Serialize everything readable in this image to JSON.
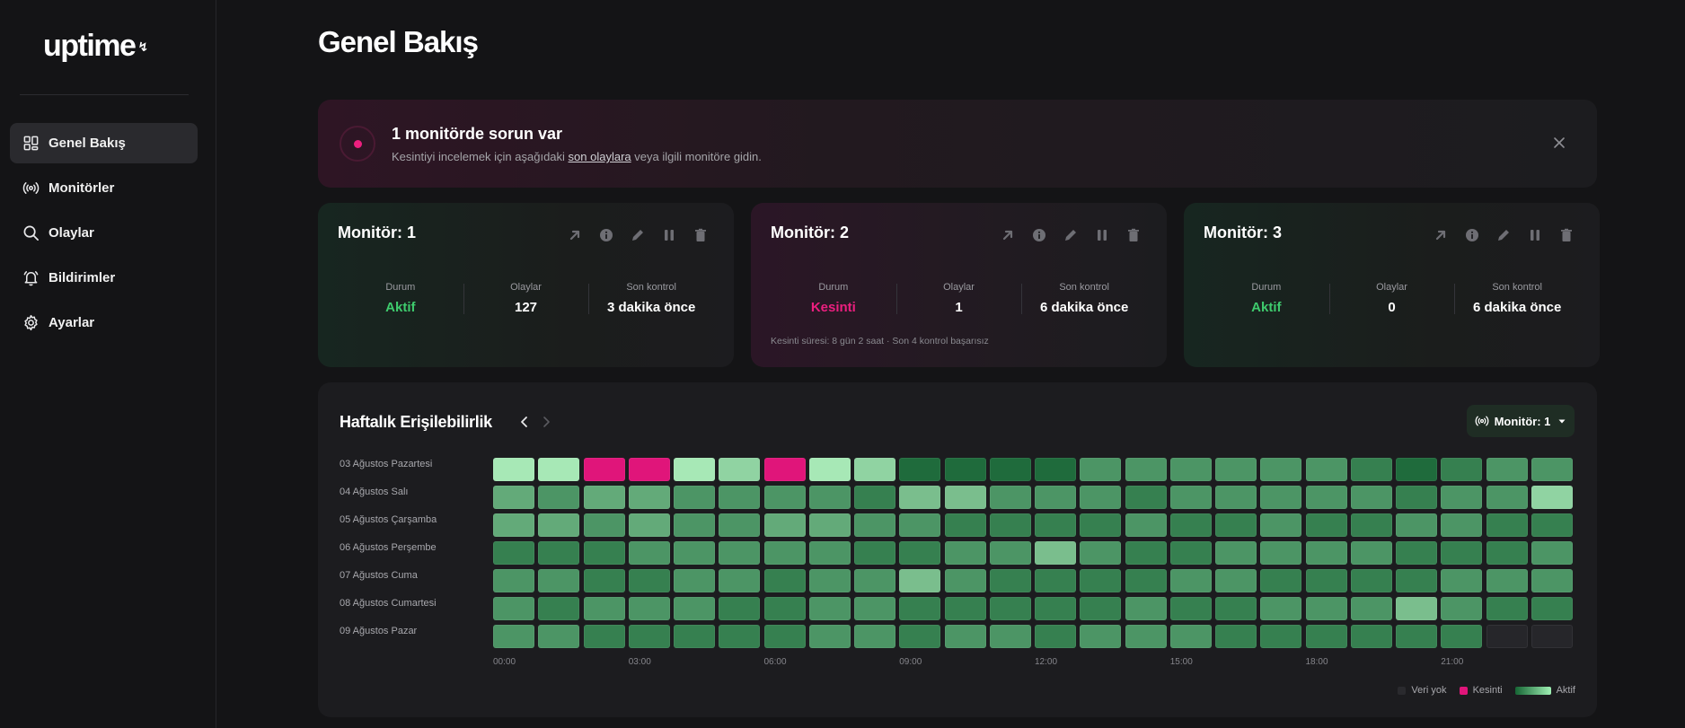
{
  "app": {
    "logo": "uptime",
    "logo_mark": "↯"
  },
  "sidebar": {
    "items": [
      {
        "label": "Genel Bakış",
        "icon": "dashboard-icon",
        "active": true
      },
      {
        "label": "Monitörler",
        "icon": "broadcast-icon",
        "active": false
      },
      {
        "label": "Olaylar",
        "icon": "search-icon",
        "active": false
      },
      {
        "label": "Bildirimler",
        "icon": "bell-icon",
        "active": false
      },
      {
        "label": "Ayarlar",
        "icon": "gear-icon",
        "active": false
      }
    ]
  },
  "page": {
    "title": "Genel Bakış"
  },
  "alert": {
    "title": "1 monitörde sorun var",
    "desc_before": "Kesintiyi incelemek için aşağıdaki ",
    "desc_link": "son olaylara",
    "desc_after": " veya ilgili monitöre gidin.",
    "accent": "#ec1f7f"
  },
  "monitors": [
    {
      "title": "Monitör: 1",
      "state": "up",
      "stats": [
        {
          "label": "Durum",
          "value": "Aktif",
          "tone": "green"
        },
        {
          "label": "Olaylar",
          "value": "127",
          "tone": ""
        },
        {
          "label": "Son kontrol",
          "value": "3 dakika önce",
          "tone": ""
        }
      ],
      "note": ""
    },
    {
      "title": "Monitör: 2",
      "state": "down",
      "stats": [
        {
          "label": "Durum",
          "value": "Kesinti",
          "tone": "pink"
        },
        {
          "label": "Olaylar",
          "value": "1",
          "tone": ""
        },
        {
          "label": "Son kontrol",
          "value": "6 dakika önce",
          "tone": ""
        }
      ],
      "note": "Kesinti süresi: 8 gün 2 saat · Son 4 kontrol başarısız"
    },
    {
      "title": "Monitör: 3",
      "state": "up",
      "stats": [
        {
          "label": "Durum",
          "value": "Aktif",
          "tone": "green"
        },
        {
          "label": "Olaylar",
          "value": "0",
          "tone": ""
        },
        {
          "label": "Son kontrol",
          "value": "6 dakika önce",
          "tone": ""
        }
      ],
      "note": ""
    }
  ],
  "card_actions": [
    "external-link-icon",
    "info-icon",
    "pencil-icon",
    "pause-icon",
    "trash-icon"
  ],
  "heatmap": {
    "title": "Haftalık Erişilebilirlik",
    "selector_label": "Monitör: 1",
    "rows": [
      "03 Ağustos Pazartesi",
      "04 Ağustos Salı",
      "05 Ağustos Çarşamba",
      "06 Ağustos Perşembe",
      "07 Ağustos Cuma",
      "08 Ağustos Cumartesi",
      "09 Ağustos Pazar"
    ],
    "x_ticks": [
      "00:00",
      "03:00",
      "06:00",
      "09:00",
      "12:00",
      "15:00",
      "18:00",
      "21:00"
    ],
    "x_tick_hours": [
      0,
      3,
      6,
      9,
      12,
      15,
      18,
      21
    ],
    "legend": {
      "no_data": "Veri yok",
      "down": "Kesinti",
      "up": "Aktif"
    },
    "colors": {
      "down": "#e0157a",
      "no_data": "#26262a",
      "up_low": "#1f6b3c",
      "up_high": "#a7e8b6"
    },
    "levels_note": "values: -1 = Veri yok, 0 = Kesinti, 1..7 = Aktif intensity (dark→light)",
    "cells": [
      [
        7,
        7,
        0,
        0,
        7,
        6,
        0,
        7,
        6,
        1,
        1,
        1,
        1,
        3,
        3,
        3,
        3,
        3,
        3,
        2,
        1,
        2,
        3,
        3
      ],
      [
        4,
        3,
        4,
        4,
        3,
        3,
        3,
        3,
        2,
        5,
        5,
        3,
        3,
        3,
        2,
        3,
        3,
        3,
        3,
        3,
        2,
        3,
        3,
        6
      ],
      [
        4,
        4,
        3,
        4,
        3,
        3,
        4,
        4,
        3,
        3,
        2,
        2,
        2,
        2,
        3,
        2,
        2,
        3,
        2,
        2,
        3,
        3,
        2,
        2
      ],
      [
        2,
        2,
        2,
        3,
        3,
        3,
        3,
        3,
        2,
        2,
        3,
        3,
        5,
        3,
        2,
        2,
        3,
        3,
        3,
        3,
        2,
        2,
        2,
        3
      ],
      [
        3,
        3,
        2,
        2,
        3,
        3,
        2,
        3,
        3,
        5,
        3,
        2,
        2,
        2,
        2,
        3,
        3,
        2,
        2,
        2,
        2,
        3,
        3,
        3
      ],
      [
        3,
        2,
        3,
        3,
        3,
        2,
        2,
        3,
        3,
        2,
        2,
        2,
        2,
        2,
        3,
        2,
        2,
        3,
        3,
        3,
        5,
        3,
        2,
        2
      ],
      [
        3,
        3,
        2,
        2,
        2,
        2,
        2,
        3,
        3,
        2,
        3,
        3,
        2,
        3,
        3,
        3,
        2,
        2,
        2,
        2,
        2,
        2,
        -1,
        -1
      ]
    ]
  }
}
